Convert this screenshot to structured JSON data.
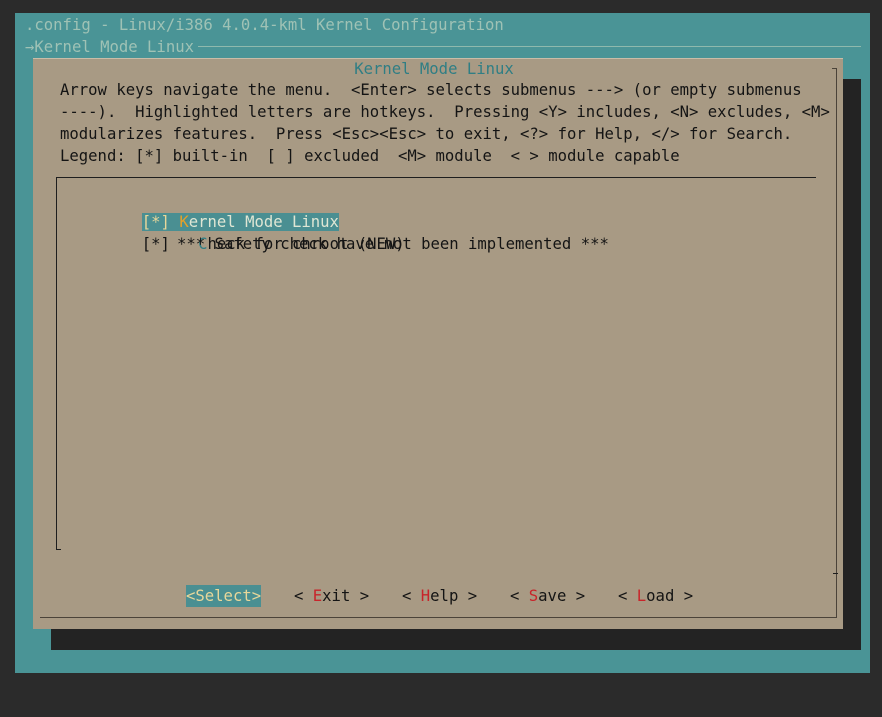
{
  "window": {
    "title": ".config - Linux/i386 4.0.4-kml Kernel Configuration",
    "breadcrumb": "→Kernel Mode Linux"
  },
  "dialog": {
    "title": "Kernel Mode Linux",
    "help_lines": [
      "Arrow keys navigate the menu.  <Enter> selects submenus ---> (or empty submenus",
      "----).  Highlighted letters are hotkeys.  Pressing <Y> includes, <N> excludes, <M>",
      "modularizes features.  Press <Esc><Esc> to exit, <?> for Help, </> for Search.",
      "Legend: [*] built-in  [ ] excluded  <M> module  < > module capable"
    ]
  },
  "menu": {
    "items": [
      {
        "state": "[*]",
        "hotkey": "K",
        "rest": "ernel Mode Linux",
        "selected": true
      },
      {
        "state": "[*]",
        "hotkey": "C",
        "rest": "heck for chroot (NEW)",
        "selected": false
      },
      {
        "comment": "*** Safety check have not been implemented ***"
      }
    ]
  },
  "buttons": [
    {
      "open": "<",
      "hotkey": "S",
      "rest": "elect",
      "close": ">",
      "active": true
    },
    {
      "open": "< ",
      "hotkey": "E",
      "rest": "xit",
      "close": " >",
      "active": false
    },
    {
      "open": "< ",
      "hotkey": "H",
      "rest": "elp",
      "close": " >",
      "active": false
    },
    {
      "open": "< ",
      "hotkey": "S",
      "rest": "ave",
      "close": " >",
      "active": false
    },
    {
      "open": "< ",
      "hotkey": "L",
      "rest": "oad",
      "close": " >",
      "active": false
    }
  ],
  "colors": {
    "terminal_bg": "#4a9496",
    "dialog_bg": "#a89a84",
    "highlight": "#4a8f92",
    "hotkey_red": "#c8242a",
    "hotkey_orange": "#e3a12b"
  }
}
